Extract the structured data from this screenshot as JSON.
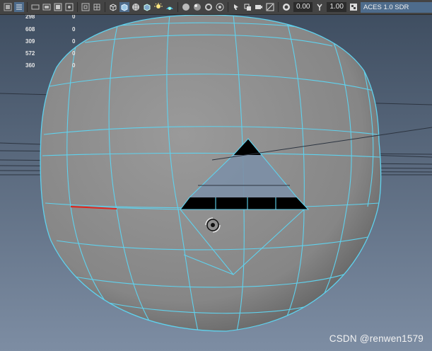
{
  "toolbar": {
    "icons": [
      "select-icon",
      "display-list-icon",
      "film-gate-icon",
      "resolution-gate-icon",
      "grid-toggle-icon",
      "field-chart-icon",
      "safe-action-icon",
      "wireframe-cube-icon",
      "smooth-shade-icon",
      "textured-icon",
      "lights-icon",
      "shadows-icon",
      "xray-icon",
      "xray-joints-icon",
      "isolate-icon",
      "ambient-occlusion-icon",
      "motion-blur-icon",
      "anti-alias-icon",
      "depth-of-field-icon",
      "isolate-select-icon",
      "xray-active-icon",
      "camera-attributes-icon",
      "bookmark-icon",
      "exposure-icon",
      "gamma-icon"
    ],
    "exposure_value": "0.00",
    "gamma_value": "1.00",
    "color_space": "ACES 1.0 SDR"
  },
  "hud": {
    "rows": [
      {
        "label": "298",
        "value": "0"
      },
      {
        "label": "608",
        "value": "0"
      },
      {
        "label": "309",
        "value": "0"
      },
      {
        "label": "572",
        "value": "0"
      },
      {
        "label": "360",
        "value": "0"
      }
    ]
  },
  "scene": {
    "background_top": "#3f4e61",
    "background_bottom": "#7d8da3",
    "mesh_color": "#8f8f8f",
    "wire_color": "#5fd2ee",
    "hole_color": "#000000",
    "selected_edge_color": "#e0241c"
  },
  "watermark": "CSDN @renwen1579"
}
